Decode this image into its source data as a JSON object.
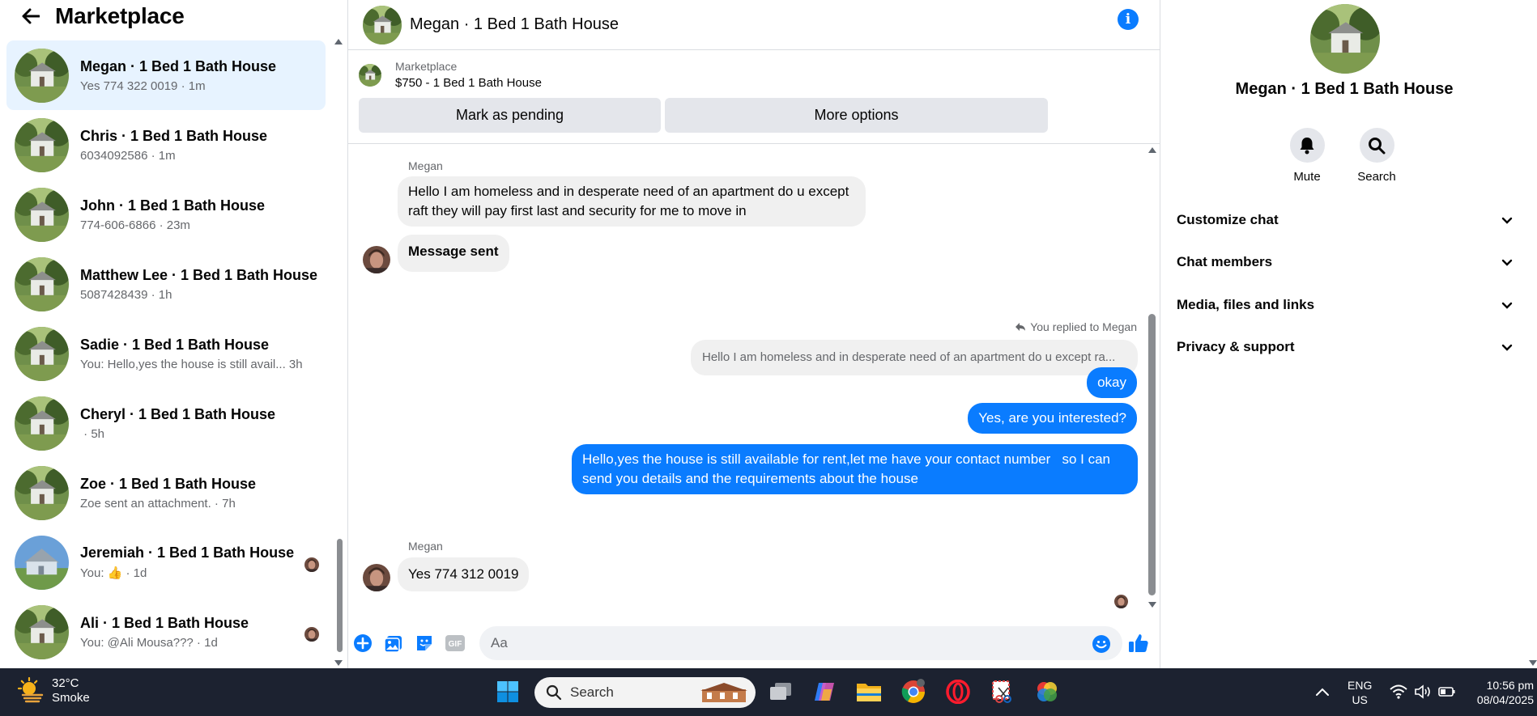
{
  "sidebar": {
    "title": "Marketplace",
    "conversations": [
      {
        "name": "Megan · 1 Bed 1 Bath House",
        "snippet": "Yes 774 322 0019",
        "time": " · 1m",
        "active": true,
        "avatar": "house"
      },
      {
        "name": "Chris · 1 Bed 1 Bath House",
        "snippet": "6034092586",
        "time": " · 1m",
        "avatar": "house"
      },
      {
        "name": "John · 1 Bed 1 Bath House",
        "snippet": "774-606-6866",
        "time": " · 23m",
        "avatar": "house"
      },
      {
        "name": "Matthew Lee · 1 Bed 1 Bath House",
        "snippet": "5087428439",
        "time": " · 1h",
        "avatar": "house"
      },
      {
        "name": "Sadie · 1 Bed 1 Bath House",
        "snippet": "You: Hello,yes the house is still avail...",
        "time": " 3h",
        "avatar": "house"
      },
      {
        "name": "Cheryl · 1 Bed 1 Bath House",
        "snippet": "",
        "time": " · 5h",
        "avatar": "house"
      },
      {
        "name": "Zoe · 1 Bed 1 Bath House",
        "snippet": "Zoe sent an attachment.",
        "time": " · 7h",
        "avatar": "house"
      },
      {
        "name": "Jeremiah · 1 Bed 1 Bath House",
        "snippet": "You: 👍",
        "time": " · 1d",
        "avatar": "house-blue"
      },
      {
        "name": "Ali · 1 Bed 1 Bath House",
        "snippet": "You: @Ali Mousa???",
        "time": " · 1d",
        "avatar": "house"
      }
    ]
  },
  "chat": {
    "title": "Megan · 1 Bed 1 Bath House",
    "marketplace_label": "Marketplace",
    "listing": "$750 - 1 Bed 1 Bath House",
    "mark_pending_label": "Mark as pending",
    "more_options_label": "More options",
    "messages": {
      "sender1": "Megan",
      "m1": "Hello I am homeless and in desperate need of an apartment do u except raft they will pay first last and security for me to move in",
      "m2": "Message sent",
      "replied_note": "You replied to Megan",
      "quoted": "Hello I am homeless and in desperate need of an apartment do u except ra...",
      "m3": "okay",
      "m4": "Yes, are you interested?",
      "m5": "Hello,yes the house is still available for rent,let me have your contact number   so I can send you details and the requirements about the house",
      "sender2": "Megan",
      "m6": "Yes 774 312 0019"
    },
    "composer_placeholder": "Aa"
  },
  "right_panel": {
    "name": "Megan · 1 Bed 1 Bath House",
    "mute_label": "Mute",
    "search_label": "Search",
    "sections": [
      "Customize chat",
      "Chat members",
      "Media, files and links",
      "Privacy & support"
    ]
  },
  "taskbar": {
    "temperature": "32°C",
    "condition": "Smoke",
    "search_label": "Search",
    "lang_top": "ENG",
    "lang_bottom": "US",
    "time": "10:56 pm",
    "date": "08/04/2025"
  },
  "colors": {
    "accent": "#0a7cff",
    "active_row": "#e7f3ff",
    "taskbar": "#1c2230"
  }
}
